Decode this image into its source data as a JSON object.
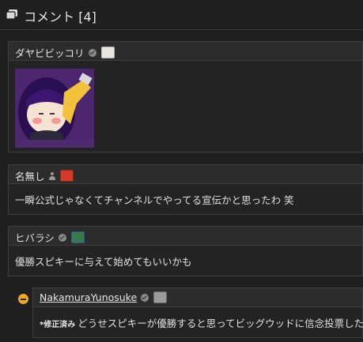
{
  "header": {
    "title": "コメント [4]"
  },
  "comments": [
    {
      "username": "ダヤビビッコリ",
      "body": ""
    },
    {
      "username": "名無し",
      "body": "一瞬公式じゃなくてチャンネルでやってる宣伝かと思ったわ 笑"
    },
    {
      "username": "ヒバラシ",
      "body": "優勝スピキーに与えて始めてもいいかも"
    },
    {
      "username": "NakamuraYunosuke",
      "edited_label": "*修正済み",
      "body": "どうせスピキーが優勝すると思ってビッグウッドに信念投票した"
    }
  ],
  "colors": {
    "background": "#1f1f1f",
    "card_header": "#2c2c2c",
    "reply_badge": "#f0a82a"
  }
}
